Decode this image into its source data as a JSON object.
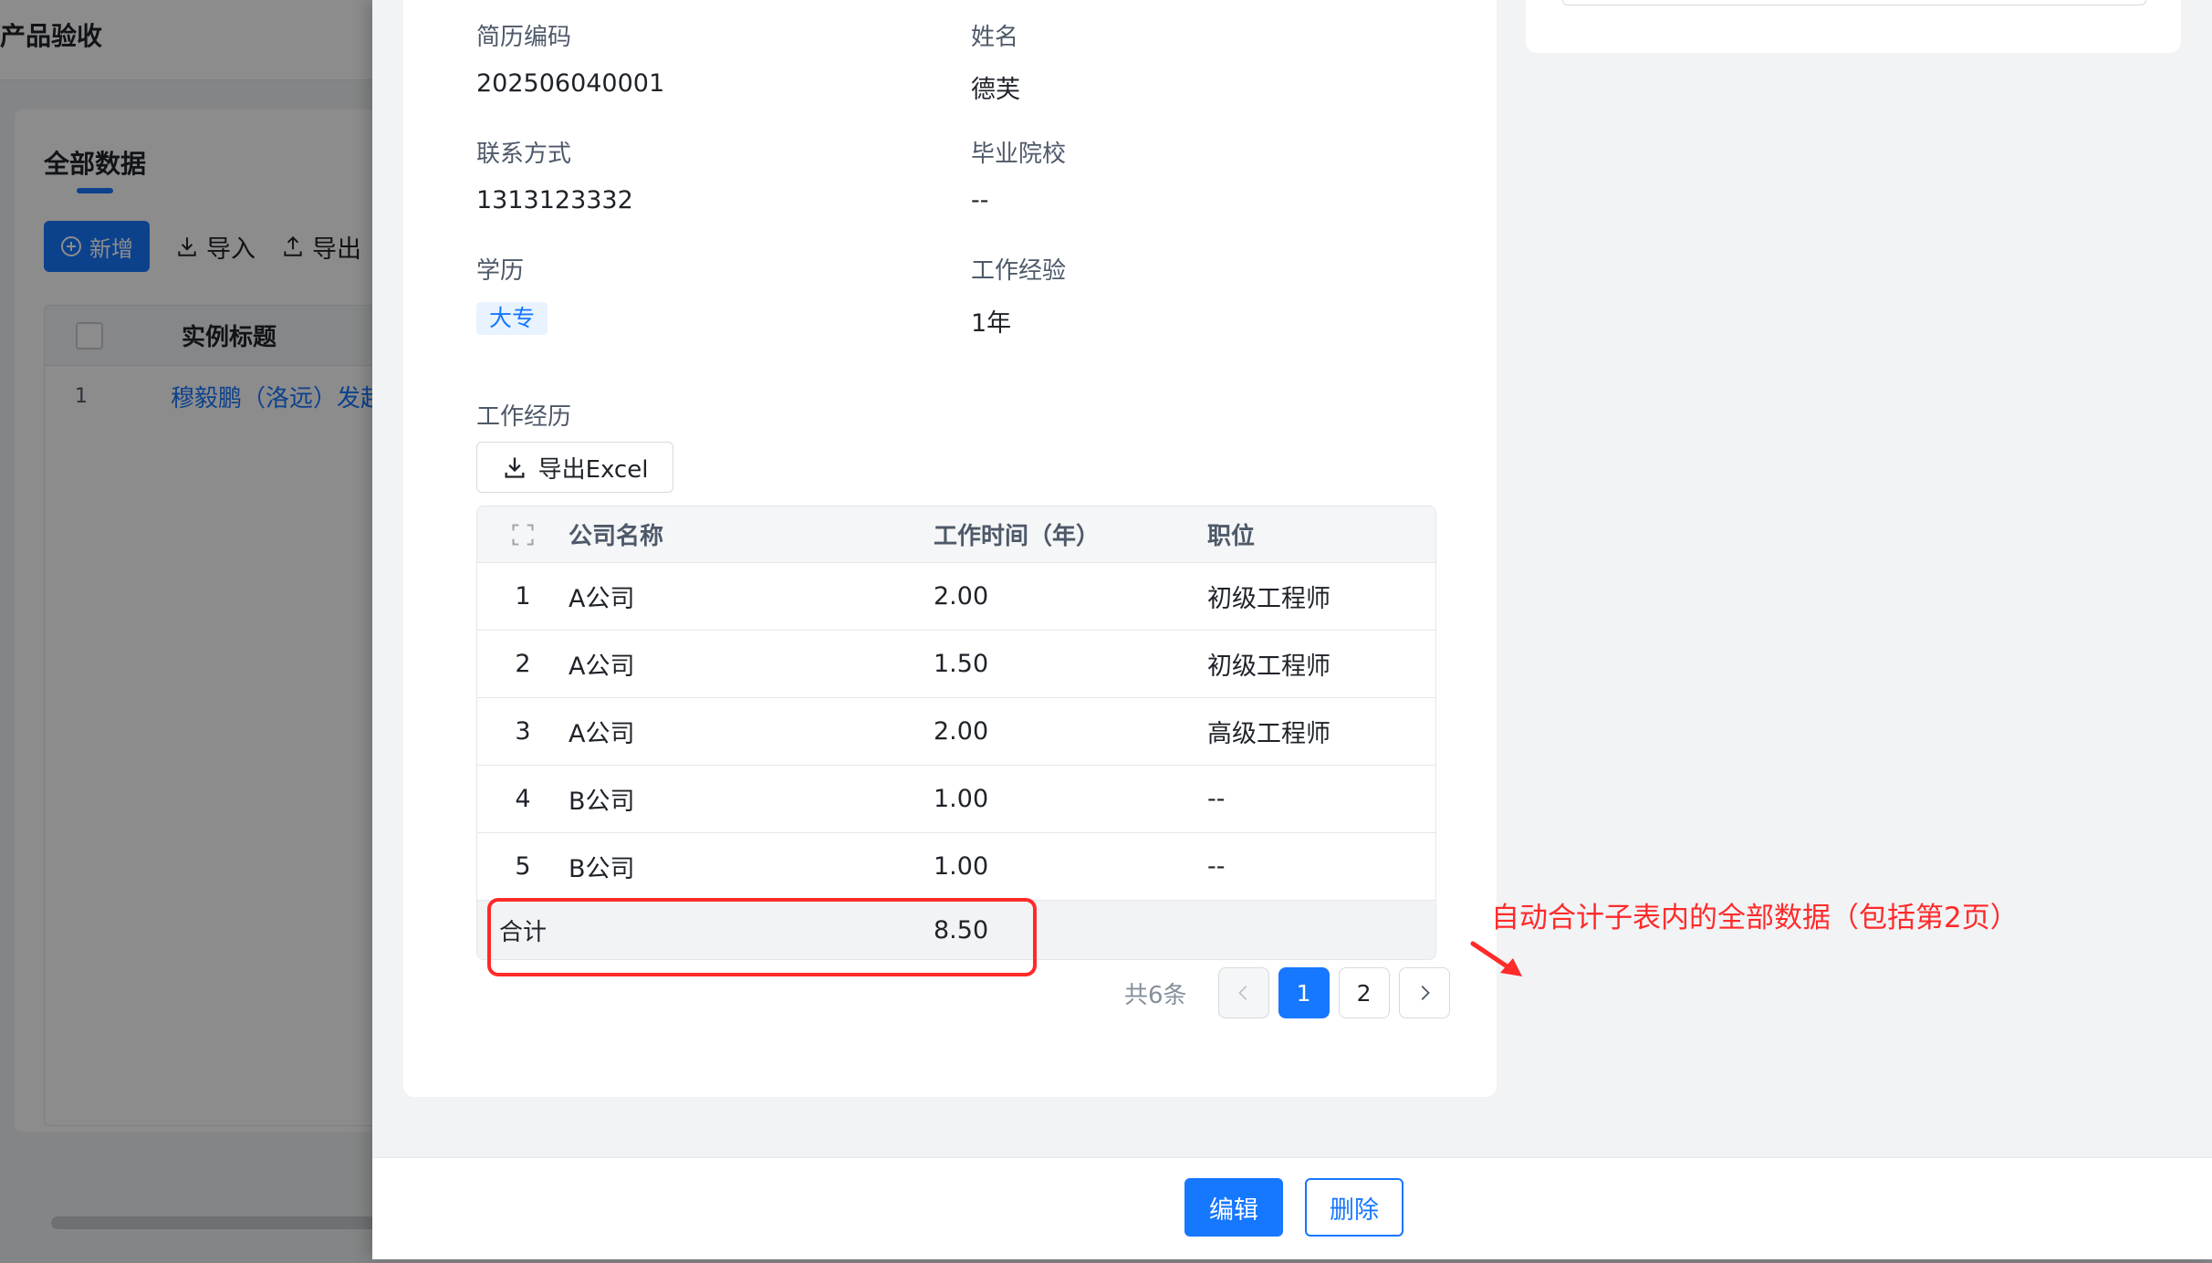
{
  "background": {
    "app_title": "产品验收",
    "tab_label": "全部数据",
    "toolbar": {
      "add_label": "新增",
      "import_label": "导入",
      "export_label": "导出"
    },
    "table": {
      "column_title": "实例标题",
      "row_index": "1",
      "row_title": "穆毅鹏（洛远）发起"
    }
  },
  "details": {
    "resume_code": {
      "label": "简历编码",
      "value": "202506040001"
    },
    "name": {
      "label": "姓名",
      "value": "德芙"
    },
    "contact": {
      "label": "联系方式",
      "value": "1313123332"
    },
    "school": {
      "label": "毕业院校",
      "value": "--"
    },
    "education": {
      "label": "学历",
      "value": "大专"
    },
    "experience": {
      "label": "工作经验",
      "value": "1年"
    }
  },
  "work_history": {
    "section_label": "工作经历",
    "export_button": "导出Excel",
    "columns": [
      "公司名称",
      "工作时间（年）",
      "职位"
    ],
    "rows": [
      {
        "index": "1",
        "company": "A公司",
        "years": "2.00",
        "position": "初级工程师"
      },
      {
        "index": "2",
        "company": "A公司",
        "years": "1.50",
        "position": "初级工程师"
      },
      {
        "index": "3",
        "company": "A公司",
        "years": "2.00",
        "position": "高级工程师"
      },
      {
        "index": "4",
        "company": "B公司",
        "years": "1.00",
        "position": "--"
      },
      {
        "index": "5",
        "company": "B公司",
        "years": "1.00",
        "position": "--"
      }
    ],
    "summary": {
      "label": "合计",
      "value": "8.50"
    },
    "pagination": {
      "total_text": "共6条",
      "pages": [
        "1",
        "2"
      ],
      "current_page": "1"
    }
  },
  "annotation": {
    "text": "自动合计子表内的全部数据（包括第2页）",
    "color": "#ff2a2a"
  },
  "footer": {
    "edit_label": "编辑",
    "delete_label": "删除"
  },
  "colors": {
    "primary": "#1677ff",
    "tag_bg": "#e8f3ff"
  },
  "icons": [
    "plus-circle-icon",
    "import-icon",
    "export-icon",
    "download-icon",
    "expand-icon",
    "chevron-left-icon",
    "chevron-right-icon",
    "arrow-icon"
  ]
}
